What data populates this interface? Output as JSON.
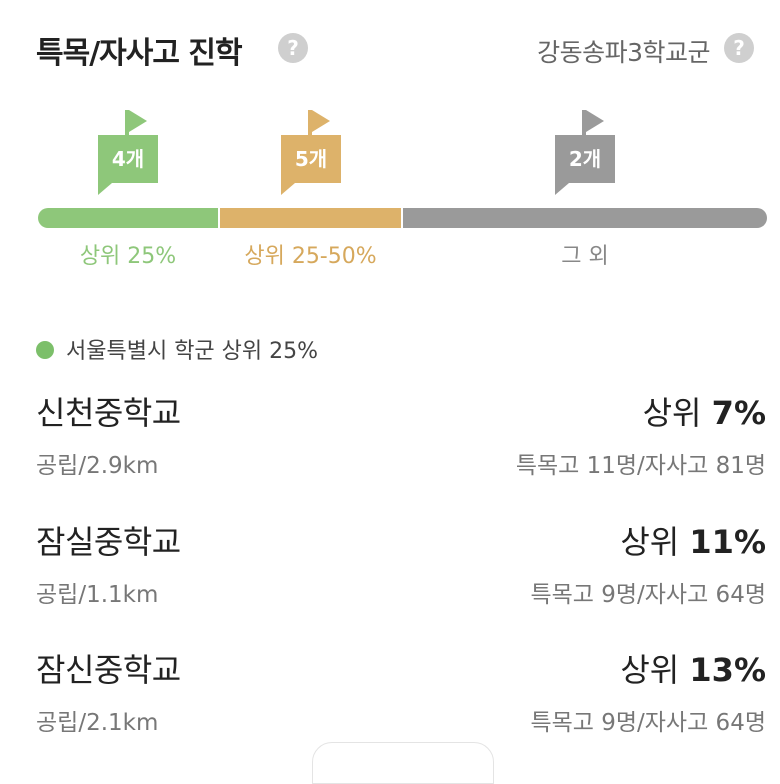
{
  "header": {
    "title": "특목/자사고 진학",
    "help_icon": "question-circle-icon",
    "district": "강동송파3학교군"
  },
  "distribution": {
    "top25": {
      "label": "상위 25%",
      "count": "4개",
      "color": "#8ec77a"
    },
    "mid": {
      "label": "상위 25-50%",
      "count": "5개",
      "color": "#ddb26a"
    },
    "rest": {
      "label": "그 외",
      "count": "2개",
      "color": "#9a9a9a"
    }
  },
  "legend": {
    "text": "서울특별시 학군 상위 25%",
    "color": "#7cbf6a"
  },
  "schools": [
    {
      "name": "신천중학교",
      "rank_prefix": "상위",
      "rank_value": "7%",
      "sub": "공립/2.9km",
      "stats": "특목고 11명/자사고 81명"
    },
    {
      "name": "잠실중학교",
      "rank_prefix": "상위",
      "rank_value": "11%",
      "sub": "공립/1.1km",
      "stats": "특목고 9명/자사고 64명"
    },
    {
      "name": "잠신중학교",
      "rank_prefix": "상위",
      "rank_value": "13%",
      "sub": "공립/2.1km",
      "stats": "특목고 9명/자사고 64명"
    }
  ]
}
